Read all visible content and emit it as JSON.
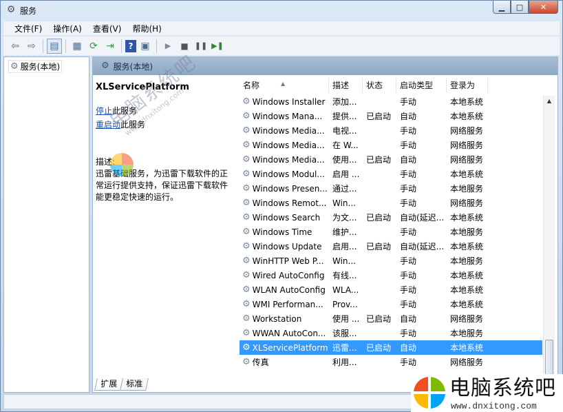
{
  "window": {
    "title": "服务",
    "icons": {
      "app": "gear-icon",
      "minimize": "minimize-icon",
      "maximize": "maximize-icon",
      "close": "close-icon"
    }
  },
  "menu": [
    "文件(F)",
    "操作(A)",
    "查看(V)",
    "帮助(H)"
  ],
  "toolbar": [
    "back-icon",
    "forward-icon",
    "show-hide-tree-icon",
    "properties-icon",
    "refresh-icon",
    "export-list-icon",
    "help-icon",
    "action-pane-icon",
    "start-service-icon",
    "stop-service-icon",
    "pause-service-icon",
    "restart-service-icon"
  ],
  "tree": {
    "root": "服务(本地)"
  },
  "pane": {
    "header": "服务(本地)"
  },
  "details": {
    "service_name": "XLServicePlatform",
    "stop_link": "停止",
    "stop_suffix": "此服务",
    "restart_link": "重启动",
    "restart_suffix": "此服务",
    "desc_label": "描述:",
    "desc_text": "迅雷基础服务，为迅雷下载软件的正常运行提供支持，保证迅雷下载软件能更稳定快速的运行。"
  },
  "columns": [
    "名称",
    "描述",
    "状态",
    "启动类型",
    "登录为"
  ],
  "services": [
    [
      "Windows Installer",
      "添加...",
      "",
      "手动",
      "本地系统"
    ],
    [
      "Windows Mana...",
      "提供...",
      "已启动",
      "自动",
      "本地系统"
    ],
    [
      "Windows Media...",
      "电视...",
      "",
      "手动",
      "网络服务"
    ],
    [
      "Windows Media...",
      "在 W...",
      "",
      "手动",
      "网络服务"
    ],
    [
      "Windows Media...",
      "使用...",
      "已启动",
      "自动",
      "网络服务"
    ],
    [
      "Windows Modul...",
      "启用 ...",
      "",
      "手动",
      "本地系统"
    ],
    [
      "Windows Presen...",
      "通过...",
      "",
      "手动",
      "本地服务"
    ],
    [
      "Windows Remot...",
      "Win...",
      "",
      "手动",
      "网络服务"
    ],
    [
      "Windows Search",
      "为文...",
      "已启动",
      "自动(延迟...",
      "本地系统"
    ],
    [
      "Windows Time",
      "维护...",
      "",
      "手动",
      "本地服务"
    ],
    [
      "Windows Update",
      "启用...",
      "已启动",
      "自动(延迟...",
      "本地系统"
    ],
    [
      "WinHTTP Web P...",
      "Win...",
      "",
      "手动",
      "本地服务"
    ],
    [
      "Wired AutoConfig",
      "有线...",
      "",
      "手动",
      "本地系统"
    ],
    [
      "WLAN AutoConfig",
      "WLA...",
      "",
      "手动",
      "本地系统"
    ],
    [
      "WMI Performan...",
      "Prov...",
      "",
      "手动",
      "本地系统"
    ],
    [
      "Workstation",
      "使用 ...",
      "已启动",
      "自动",
      "网络服务"
    ],
    [
      "WWAN AutoCon...",
      "该服...",
      "",
      "手动",
      "本地服务"
    ],
    [
      "XLServicePlatform",
      "迅雷...",
      "已启动",
      "自动",
      "本地系统"
    ],
    [
      "传真",
      "利用...",
      "",
      "手动",
      "网络服务"
    ]
  ],
  "selected_row": 17,
  "tabs": [
    "扩展",
    "标准"
  ],
  "watermark": {
    "cn": "电脑系统吧",
    "url": "www.dnxitong.com"
  },
  "brand": {
    "cn": "电脑系统吧",
    "url": "www.dnxitong.com"
  }
}
